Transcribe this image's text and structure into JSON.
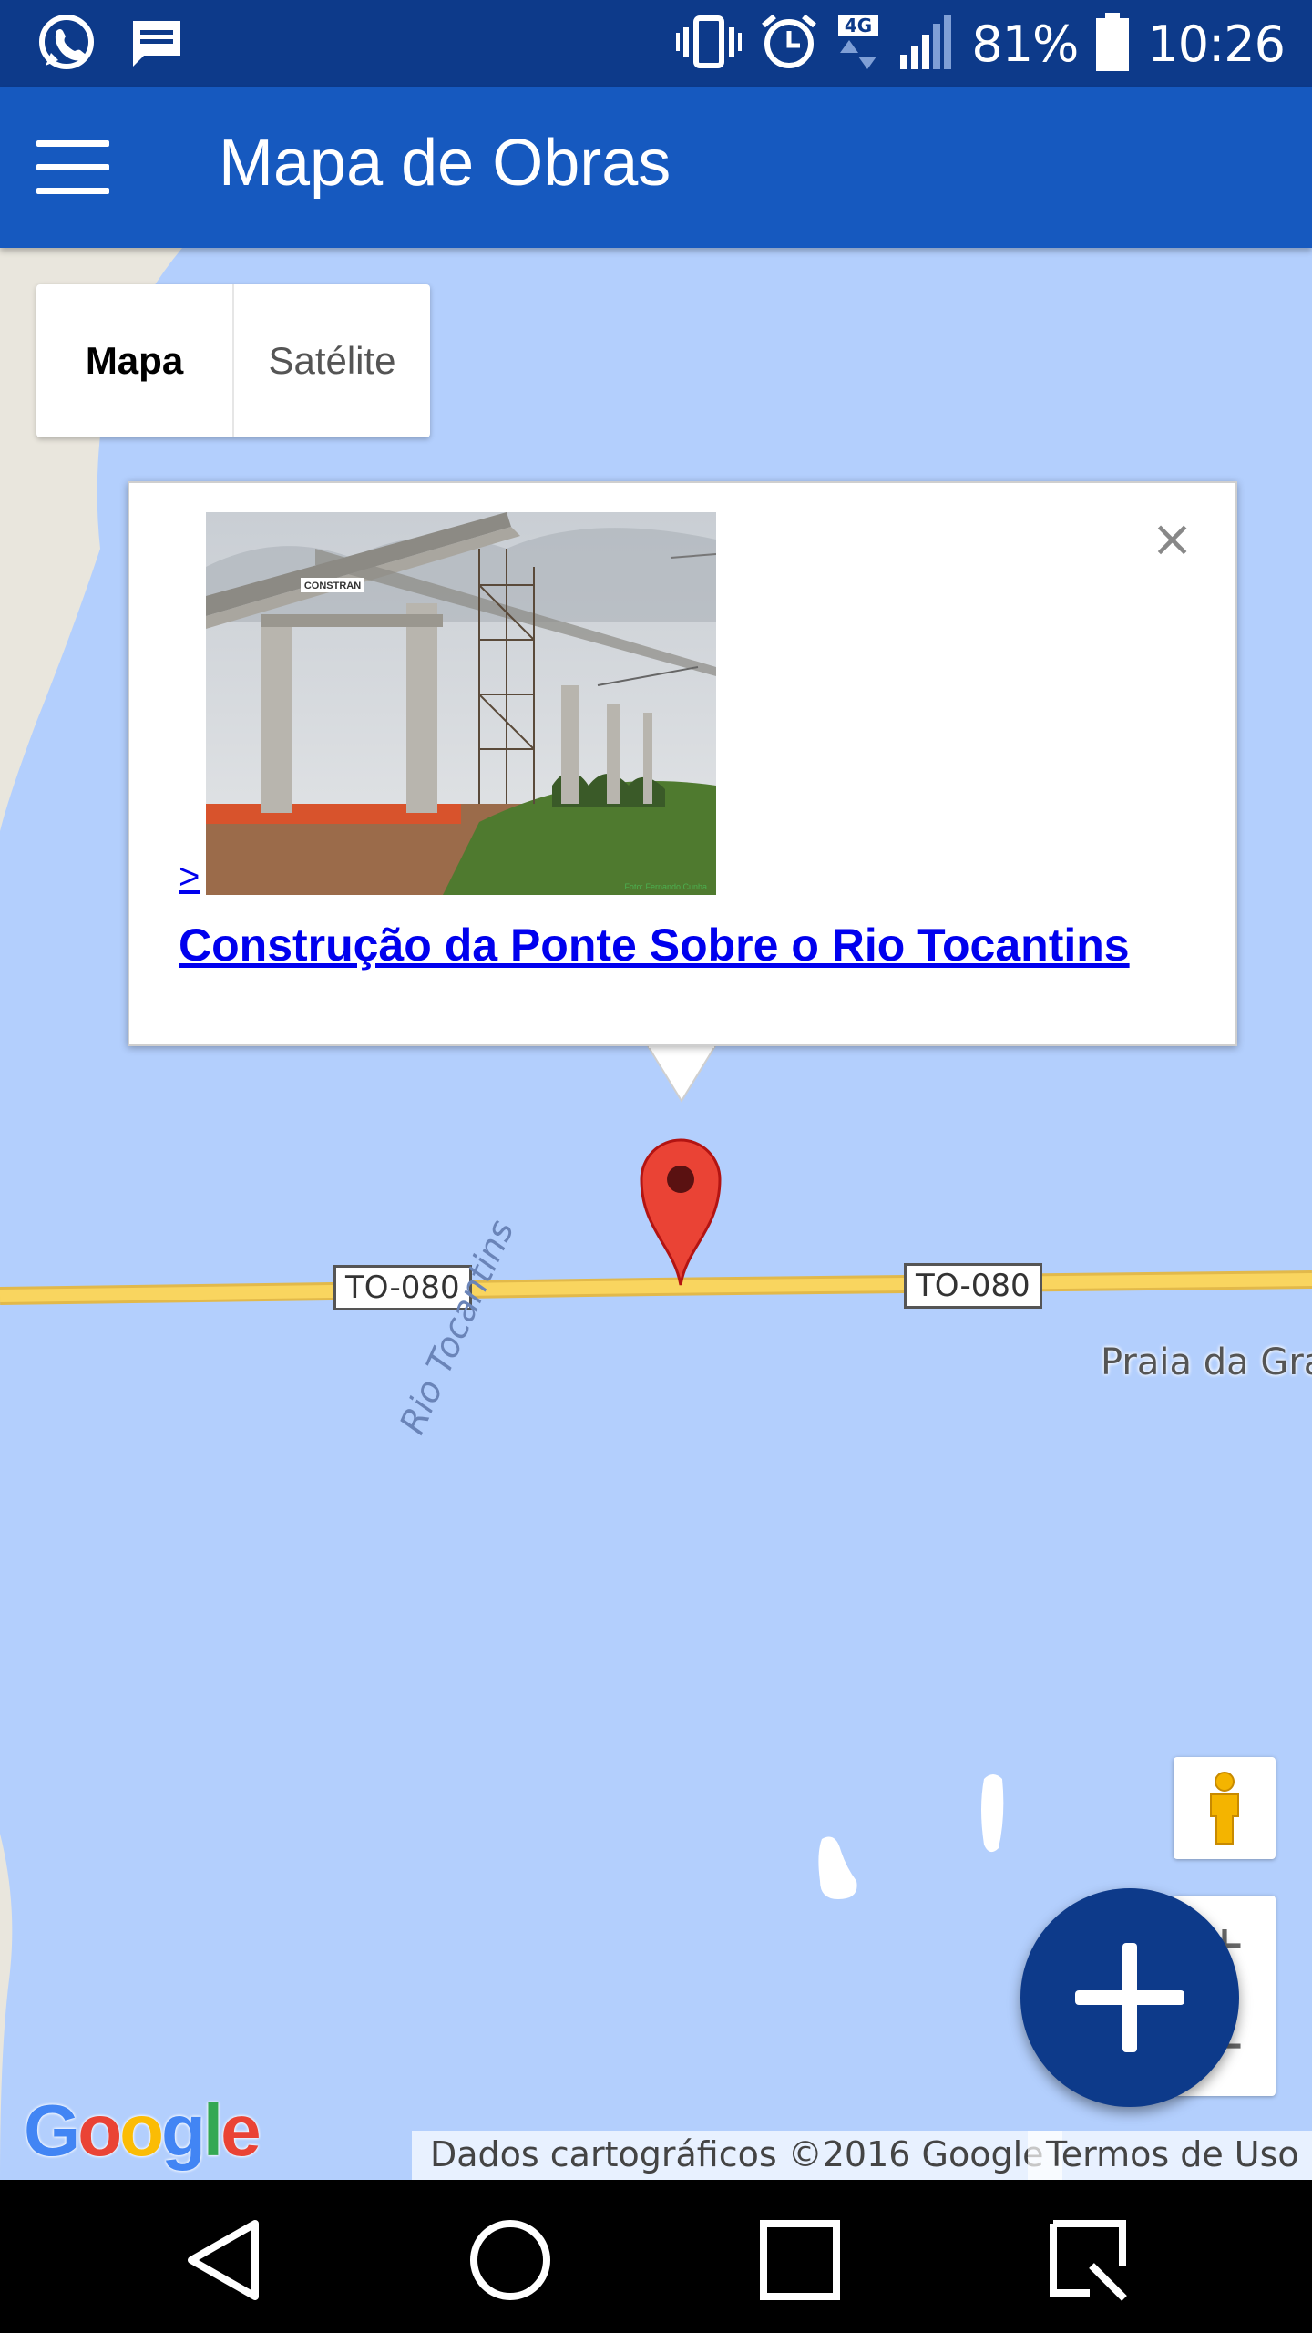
{
  "status_bar": {
    "battery_percent": "81%",
    "time": "10:26",
    "network": "4G",
    "icons": [
      "whatsapp-icon",
      "message-icon",
      "vibrate-icon",
      "alarm-icon",
      "network-4g-icon",
      "signal-icon",
      "battery-icon"
    ]
  },
  "app_bar": {
    "title": "Mapa de Obras",
    "menu_icon": "hamburger-menu-icon"
  },
  "map": {
    "map_type": {
      "options": [
        "Mapa",
        "Satélite"
      ],
      "selected": "Mapa"
    },
    "info_window": {
      "arrow_text": ">",
      "link_text": "Construção da Ponte Sobre o Rio Tocantins",
      "close_symbol": "×",
      "photo_caption": "Foto: Fernando Cunha",
      "photo_sign": "CONSTRAN"
    },
    "road_shields": [
      "TO-080",
      "TO-080"
    ],
    "place_label": "Praia da Gra",
    "river_label": "Rio Tocantins",
    "zoom": {
      "in": "+",
      "out": "−"
    },
    "logo": "Google",
    "attribution": "Dados cartográficos ©2016 Google",
    "terms": "Termos de Uso",
    "colors": {
      "water": "#b3cffd",
      "road": "#f9d55f",
      "marker": "#ea4335",
      "fab": "#0d3a8a",
      "appbar": "#1659bf"
    }
  },
  "nav_bar": {
    "buttons": [
      "back-icon",
      "home-icon",
      "recents-icon",
      "screenshot-icon"
    ]
  }
}
